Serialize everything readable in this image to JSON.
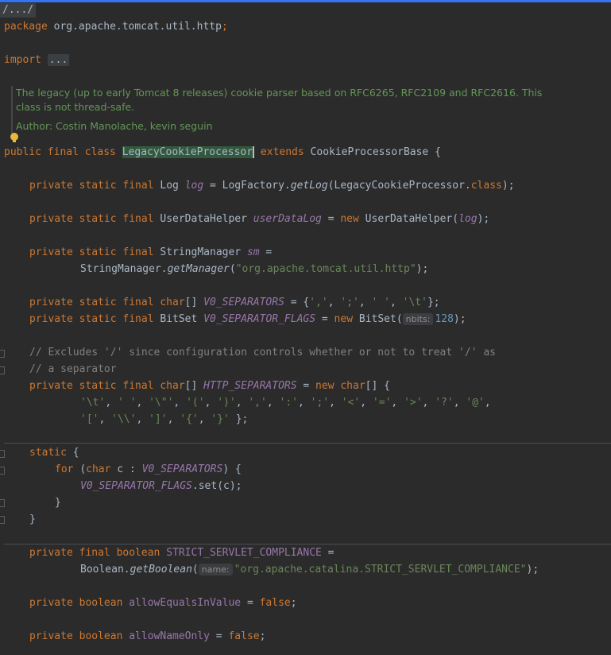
{
  "editor": {
    "breadcrumb": "/.../",
    "package_kw": "package",
    "package_name": "org.apache.tomcat.util.http",
    "import_kw": "import",
    "import_fold": "...",
    "doc": {
      "line1": "The legacy (up to early Tomcat 8 releases) cookie parser based on RFC6265, RFC2109 and RFC2616. This",
      "line2": "class is not thread-safe.",
      "author": "Author: Costin Manolache, kevin seguin"
    },
    "class_name": "LegacyCookieProcessor",
    "base_class": "CookieProcessorBase",
    "hint_nbits": "nbits:",
    "hint_name": "name:",
    "comment1": "// Excludes '/' since configuration controls whether or not to treat '/' as",
    "comment2": "// a separator"
  },
  "colors": {
    "background": "#2b2b2b",
    "keyword": "#cc7832",
    "field": "#9876aa",
    "string": "#6a8759",
    "number": "#6897bb",
    "comment": "#808080",
    "doc": "#629755",
    "accent": "#3574f0"
  }
}
